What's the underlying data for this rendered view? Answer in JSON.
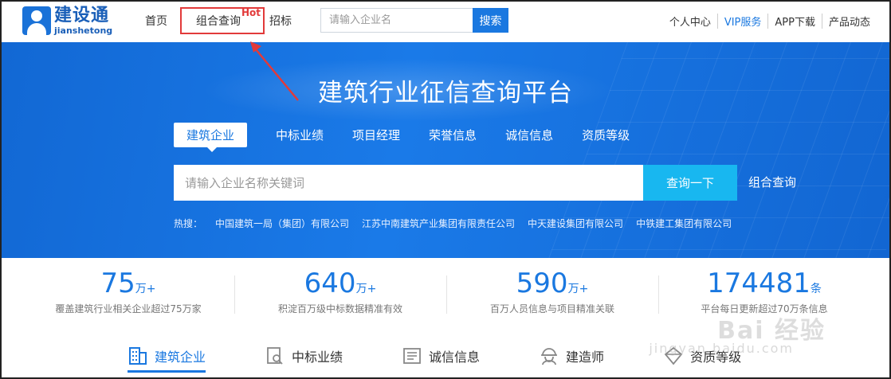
{
  "header": {
    "logo_cn": "建设通",
    "logo_en": "jianshetong",
    "nav": {
      "home": "首页",
      "combo": "组合查询",
      "bid": "招标"
    },
    "hot_tag": "Hot",
    "search": {
      "placeholder": "请输入企业名",
      "button": "搜索"
    },
    "right_links": [
      "个人中心",
      "VIP服务",
      "APP下载",
      "产品动态"
    ]
  },
  "hero": {
    "title": "建筑行业征信查询平台",
    "tabs": [
      "建筑企业",
      "中标业绩",
      "项目经理",
      "荣誉信息",
      "诚信信息",
      "资质等级"
    ],
    "search": {
      "placeholder": "请输入企业名称关键词",
      "button": "查询一下"
    },
    "combo_link": "组合查询",
    "hot_label": "热搜：",
    "hot_items": [
      "中国建筑一局（集团）有限公司",
      "江苏中南建筑产业集团有限责任公司",
      "中天建设集团有限公司",
      "中铁建工集团有限公司"
    ]
  },
  "stats": [
    {
      "value": "75",
      "unit": "万+",
      "desc": "覆盖建筑行业相关企业超过75万家"
    },
    {
      "value": "640",
      "unit": "万+",
      "desc": "积淀百万级中标数据精准有效"
    },
    {
      "value": "590",
      "unit": "万+",
      "desc": "百万人员信息与项目精准关联"
    },
    {
      "value": "174481",
      "unit": "条",
      "desc": "平台每日更新超过70万条信息"
    }
  ],
  "bottom_tabs": [
    "建筑企业",
    "中标业绩",
    "诚信信息",
    "建造师",
    "资质等级"
  ],
  "watermark": {
    "line1": "Bai 经验",
    "line2": "jingyan.baidu.com"
  },
  "colors": {
    "primary": "#1a78e0",
    "hero": "#1a7ae8",
    "accent": "#18b7f0",
    "highlight": "#e23a3a"
  }
}
